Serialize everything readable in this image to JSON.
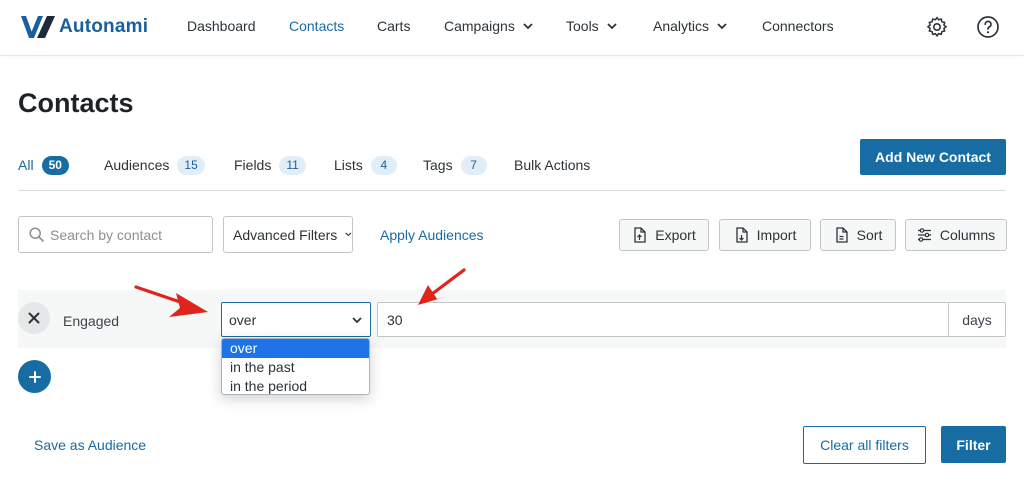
{
  "brand": {
    "name": "Autonami",
    "color": "#1a5f9e"
  },
  "nav": {
    "items": [
      {
        "label": "Dashboard"
      },
      {
        "label": "Contacts",
        "active": true
      },
      {
        "label": "Carts"
      },
      {
        "label": "Campaigns",
        "has_dropdown": true
      },
      {
        "label": "Tools",
        "has_dropdown": true
      },
      {
        "label": "Analytics",
        "has_dropdown": true
      },
      {
        "label": "Connectors"
      }
    ],
    "icons": [
      "gear-icon",
      "help-icon"
    ]
  },
  "page": {
    "title": "Contacts"
  },
  "tabs": [
    {
      "label": "All",
      "count": "50",
      "active": true
    },
    {
      "label": "Audiences",
      "count": "15"
    },
    {
      "label": "Fields",
      "count": "11"
    },
    {
      "label": "Lists",
      "count": "4"
    },
    {
      "label": "Tags",
      "count": "7"
    },
    {
      "label": "Bulk Actions"
    }
  ],
  "add_contact_label": "Add New Contact",
  "toolbar": {
    "search_placeholder": "Search by contact",
    "advanced_filters_label": "Advanced Filters",
    "apply_audiences_label": "Apply Audiences",
    "export_label": "Export",
    "import_label": "Import",
    "sort_label": "Sort",
    "columns_label": "Columns"
  },
  "filter": {
    "field_label": "Engaged",
    "operator_selected": "over",
    "operator_options": [
      "over",
      "in the past",
      "in the period"
    ],
    "value": "30",
    "unit": "days"
  },
  "footer": {
    "save_audience_label": "Save as Audience",
    "clear_filters_label": "Clear all filters",
    "filter_label": "Filter"
  },
  "colors": {
    "primary": "#166ca3",
    "link": "#1a6aa3",
    "annotation_arrow": "#e0231b",
    "dropdown_highlight": "#1e73e8"
  }
}
